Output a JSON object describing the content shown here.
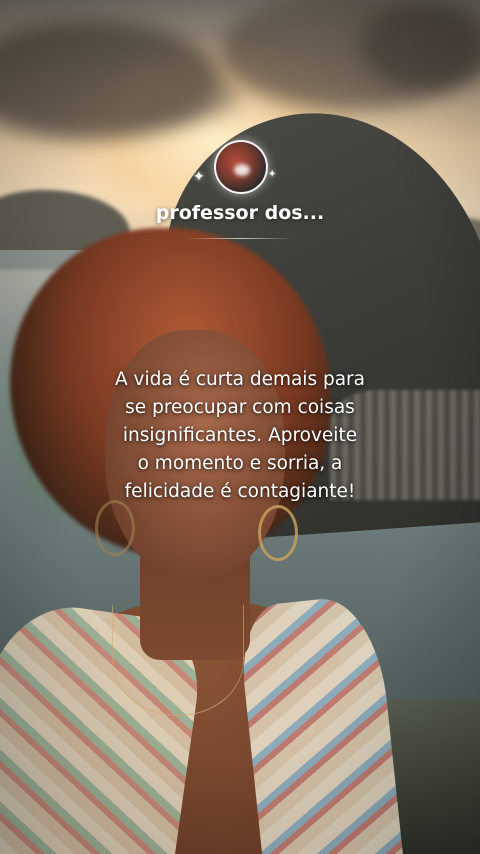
{
  "channel": {
    "name": "professor dos...",
    "avatar_icon": "channel-avatar",
    "sparkle_icon": "sparkle-icon"
  },
  "quote": {
    "lines": [
      "A vida é curta demais para",
      "se preocupar com coisas",
      "insignificantes. Aproveite",
      "o momento e sorria, a",
      "felicidade é contagiante!"
    ]
  },
  "colors": {
    "text": "#ffffff",
    "sky_glow": "#f1dcbc"
  }
}
